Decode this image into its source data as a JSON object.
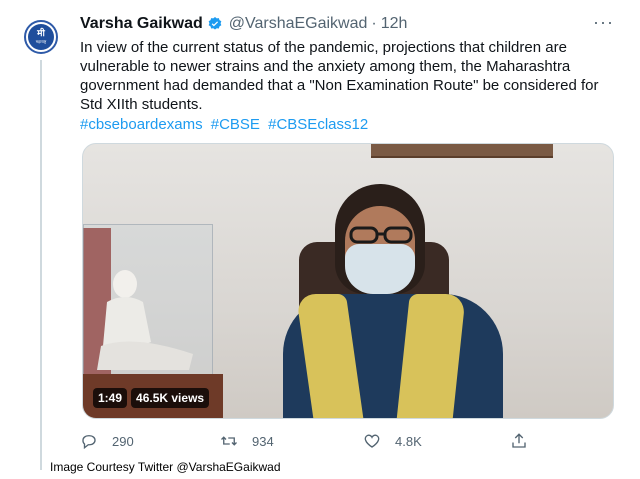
{
  "tweet": {
    "author_name": "Varsha Gaikwad",
    "handle": "@VarshaEGaikwad",
    "separator": "·",
    "time": "12h",
    "more": "···",
    "avatar_text": "मी",
    "avatar_subtext": "महाराष्ट्र",
    "text": "In view of the current status of the pandemic, projections that children are vulnerable to newer strains and the anxiety among them, the Maharashtra government had demanded that a \"Non Examination Route\" be considered for Std XIIth students.",
    "hashtags": [
      "#cbseboardexams",
      "#CBSE",
      "#CBSEclass12"
    ],
    "media": {
      "duration": "1:49",
      "views": "46.5K views"
    },
    "actions": {
      "replies": "290",
      "retweets": "934",
      "likes": "4.8K"
    }
  },
  "caption": "Image Courtesy Twitter @VarshaEGaikwad",
  "icons": {
    "verified": "verified-badge-icon",
    "reply": "reply-icon",
    "retweet": "retweet-icon",
    "like": "heart-icon",
    "share": "share-icon",
    "more": "more-icon"
  },
  "colors": {
    "accent": "#1d9bf0",
    "muted": "#536471",
    "text": "#0f1419"
  }
}
